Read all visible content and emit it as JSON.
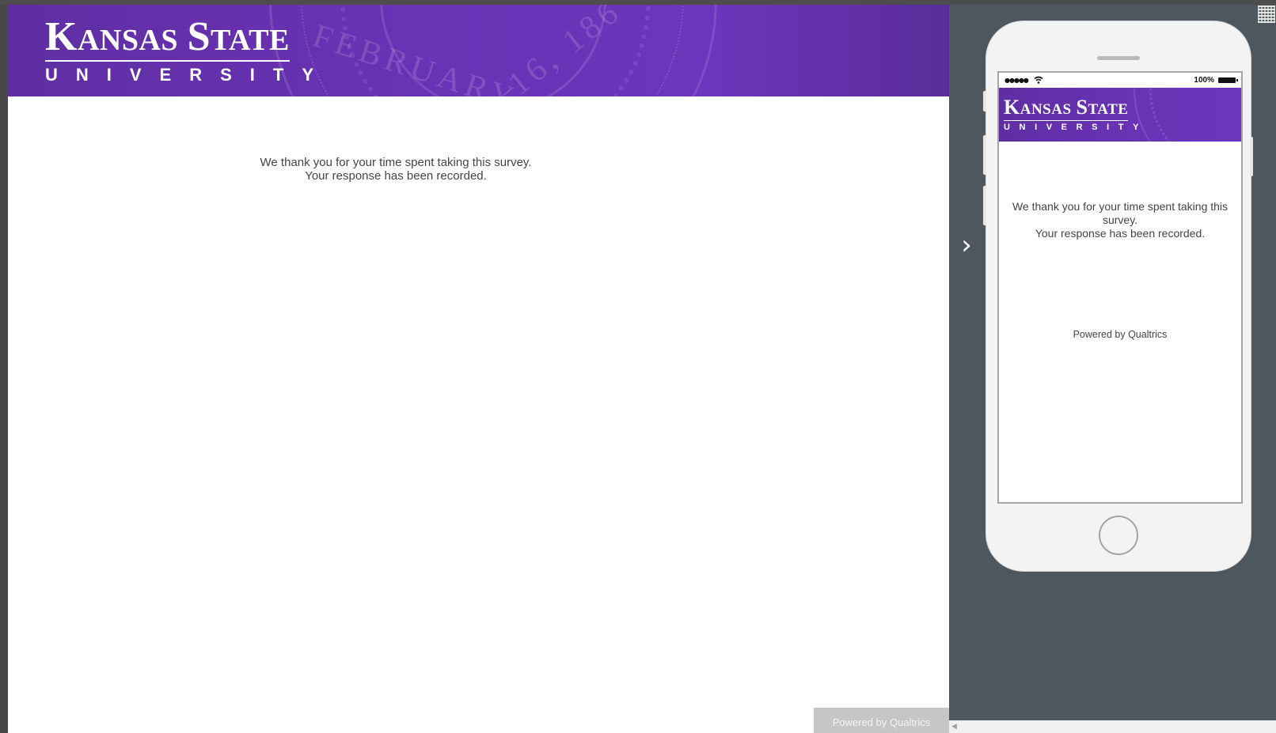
{
  "brand": {
    "name_line1_first_initial": "K",
    "name_line1_first_rest": "ANSAS",
    "name_line1_second_initial": "S",
    "name_line1_second_rest": "TATE",
    "name_line2": "UNIVERSITY",
    "seal_text_a": "FEBRUARY",
    "seal_text_b": "16, 186",
    "primary_color": "#6a33b6"
  },
  "survey": {
    "thanks_line1": "We thank you for your time spent taking this survey.",
    "thanks_line2": "Your response has been recorded.",
    "powered_by": "Powered by Qualtrics"
  },
  "mobile_preview": {
    "battery_label": "100%",
    "thanks_line1": "We thank you for your time spent taking this survey.",
    "thanks_line2": "Your response has been recorded.",
    "powered_by": "Powered by Qualtrics",
    "toggle_glyph": "›",
    "signal_glyph": "●●●●●"
  },
  "icons": {
    "toggle": "chevron-right-icon",
    "qr": "qr-code-icon",
    "wifi": "wifi-icon",
    "battery": "battery-icon",
    "home": "home-button"
  },
  "colors": {
    "preview_background": "#4e565e",
    "powered_badge": "#c6c6c6"
  }
}
